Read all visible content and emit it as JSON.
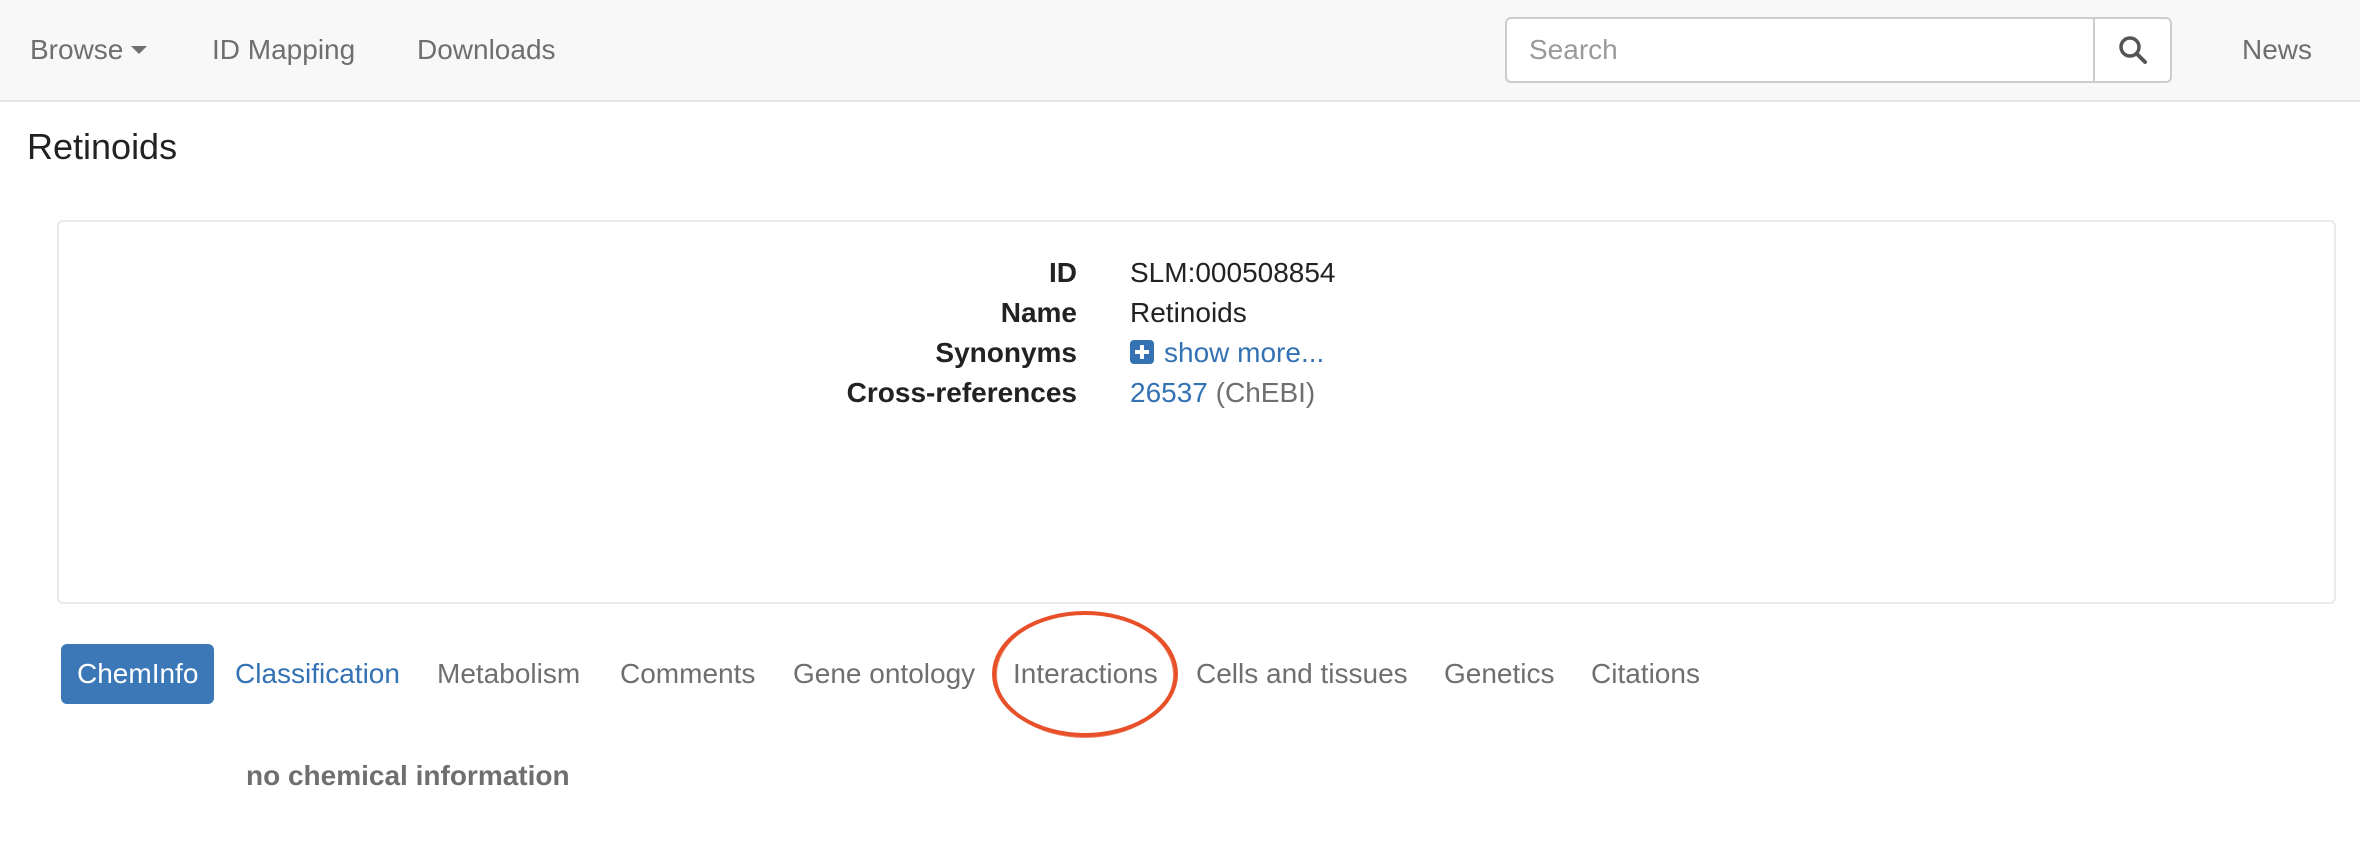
{
  "navbar": {
    "browse_label": "Browse",
    "id_mapping_label": "ID Mapping",
    "downloads_label": "Downloads",
    "search_placeholder": "Search",
    "news_label": "News"
  },
  "page": {
    "title": "Retinoids"
  },
  "info": {
    "id_label": "ID",
    "id_value": "SLM:000508854",
    "name_label": "Name",
    "name_value": "Retinoids",
    "synonyms_label": "Synonyms",
    "synonyms_link": "show more...",
    "xref_label": "Cross-references",
    "xref_link": "26537",
    "xref_source": "(ChEBI)"
  },
  "tabs": [
    {
      "label": "ChemInfo",
      "state": "active"
    },
    {
      "label": "Classification",
      "state": "link"
    },
    {
      "label": "Metabolism",
      "state": "normal"
    },
    {
      "label": "Comments",
      "state": "normal"
    },
    {
      "label": "Gene ontology",
      "state": "normal"
    },
    {
      "label": "Interactions",
      "state": "highlighted"
    },
    {
      "label": "Cells and tissues",
      "state": "normal"
    },
    {
      "label": "Genetics",
      "state": "normal"
    },
    {
      "label": "Citations",
      "state": "normal"
    }
  ],
  "content": {
    "message": "no chemical information"
  },
  "colors": {
    "link": "#3472b3",
    "active_tab": "#3c78b8",
    "highlight": "#e8502a"
  },
  "icons": {
    "search": "search-icon",
    "caret": "caret-down-icon",
    "plus": "plus-square-icon"
  }
}
